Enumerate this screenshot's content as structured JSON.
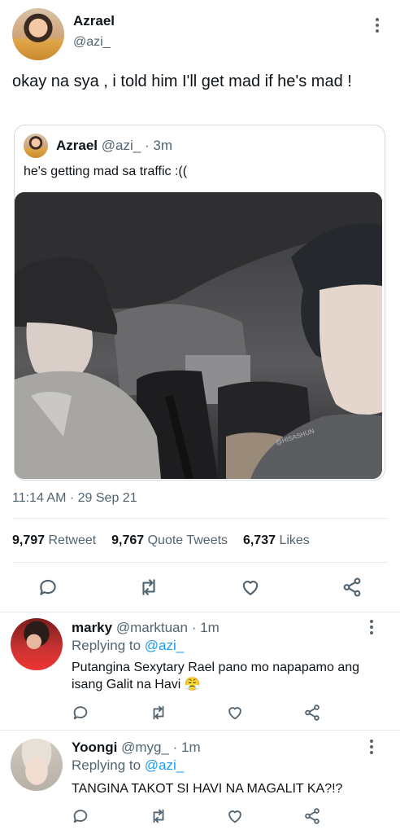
{
  "tweet": {
    "author_name": "Azrael",
    "author_handle": "@azi_",
    "text": "okay na sya , i told him I'll get mad if he's mad !",
    "quote": {
      "author_name": "Azrael",
      "author_handle": "@azi_",
      "separator": "·",
      "time": "3m",
      "text": "he's getting mad sa traffic :((",
      "watermark": "@HISASHUN"
    },
    "timestamp": "11:14 AM · 29 Sep 21",
    "stats": {
      "retweets_count": "9,797",
      "retweets_label": "Retweet",
      "quotes_count": "9,767",
      "quotes_label": "Quote Tweets",
      "likes_count": "6,737",
      "likes_label": "Likes"
    }
  },
  "replies": [
    {
      "name": "marky",
      "handle": "@marktuan",
      "separator": "·",
      "time": "1m",
      "replying_label": "Replying to",
      "replying_handle": "@azi_",
      "text": "Putangina Sexytary Rael pano mo napapamo ang isang Galit na Havi 😤"
    },
    {
      "name": "Yoongi",
      "handle": "@myg_",
      "separator": "·",
      "time": "1m",
      "replying_label": "Replying to",
      "replying_handle": "@azi_",
      "text": "TANGINA TAKOT SI HAVI NA MAGALIT KA?!?"
    }
  ],
  "icons": [
    "more-vertical-icon",
    "reply-icon",
    "retweet-icon",
    "like-icon",
    "share-icon"
  ],
  "colors": {
    "text": "#0f1419",
    "secondary": "#536471",
    "accent": "#1d9bf0",
    "divider": "#e6ecf0"
  }
}
